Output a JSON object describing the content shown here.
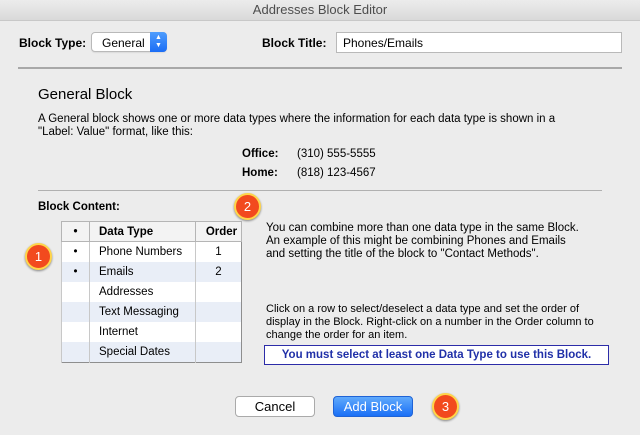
{
  "window": {
    "title": "Addresses Block Editor"
  },
  "header": {
    "block_type_label": "Block Type:",
    "block_type_value": "General",
    "block_title_label": "Block Title:",
    "block_title_value": "Phones/Emails"
  },
  "general": {
    "heading": "General Block",
    "description_line1": "A General block shows one or more data types where the information for each data type is shown in a",
    "description_line2": "\"Label: Value\" format, like this:",
    "example": [
      {
        "label": "Office:",
        "value": "(310) 555-5555"
      },
      {
        "label": "Home:",
        "value": "(818) 123-4567"
      }
    ]
  },
  "content": {
    "label": "Block Content:",
    "table": {
      "headers": [
        "•",
        "Data Type",
        "Order"
      ],
      "rows": [
        {
          "bullet": "•",
          "type": "Phone Numbers",
          "order": "1"
        },
        {
          "bullet": "•",
          "type": "Emails",
          "order": "2"
        },
        {
          "bullet": "",
          "type": "Addresses",
          "order": ""
        },
        {
          "bullet": "",
          "type": "Text Messaging",
          "order": ""
        },
        {
          "bullet": "",
          "type": "Internet",
          "order": ""
        },
        {
          "bullet": "",
          "type": "Special Dates",
          "order": ""
        }
      ]
    },
    "info_lines": [
      "You can combine more than one data type in the same Block.",
      "An example of this might be combining Phones and Emails",
      "and setting the title of the block to \"Contact Methods\"."
    ],
    "help_lines": [
      "Click on a row to select/deselect a data type and set the order of",
      "display in the Block. Right-click on a number in the Order column to",
      "change the order for an item."
    ],
    "warning": "You must select at least one Data Type to use this Block."
  },
  "callouts": [
    "1",
    "2",
    "3"
  ],
  "buttons": {
    "cancel": "Cancel",
    "add": "Add Block"
  },
  "colors": {
    "accent_blue": "#1a6ff6",
    "callout_red": "#f24a1e",
    "callout_ring": "#ffd54a",
    "warning_text": "#2030a8"
  },
  "icons": {
    "popup_arrows": "up-down-chevron-icon"
  }
}
